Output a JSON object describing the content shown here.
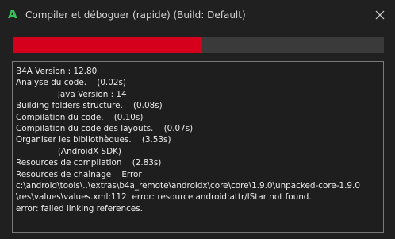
{
  "window": {
    "title": "Compiler et déboguer (rapide) (Build: Default)",
    "app_icon_letter": "A",
    "app_icon_color": "#34c759",
    "close_icon": "close-icon"
  },
  "progress": {
    "fraction": 0.51,
    "fill_color": "#d5001c",
    "track_color": "#3a3a3a"
  },
  "log": {
    "lines": [
      "B4A Version : 12.80",
      "Analyse du code.    (0.02s)",
      "                Java Version : 14",
      "Building folders structure.    (0.08s)",
      "Compilation du code.    (0.10s)",
      "Compilation du code des layouts.    (0.07s)",
      "Organiser les bibliothèques.    (3.53s)",
      "                (AndroidX SDK)",
      "Resources de compilation    (2.83s)",
      "Resources de chaînage    Error",
      "c:\\android\\tools\\..\\extras\\b4a_remote\\androidx\\core\\core\\1.9.0\\unpacked-core-1.9.0",
      "\\res\\values\\values.xml:112: error: resource android:attr/lStar not found.",
      "error: failed linking references."
    ]
  }
}
